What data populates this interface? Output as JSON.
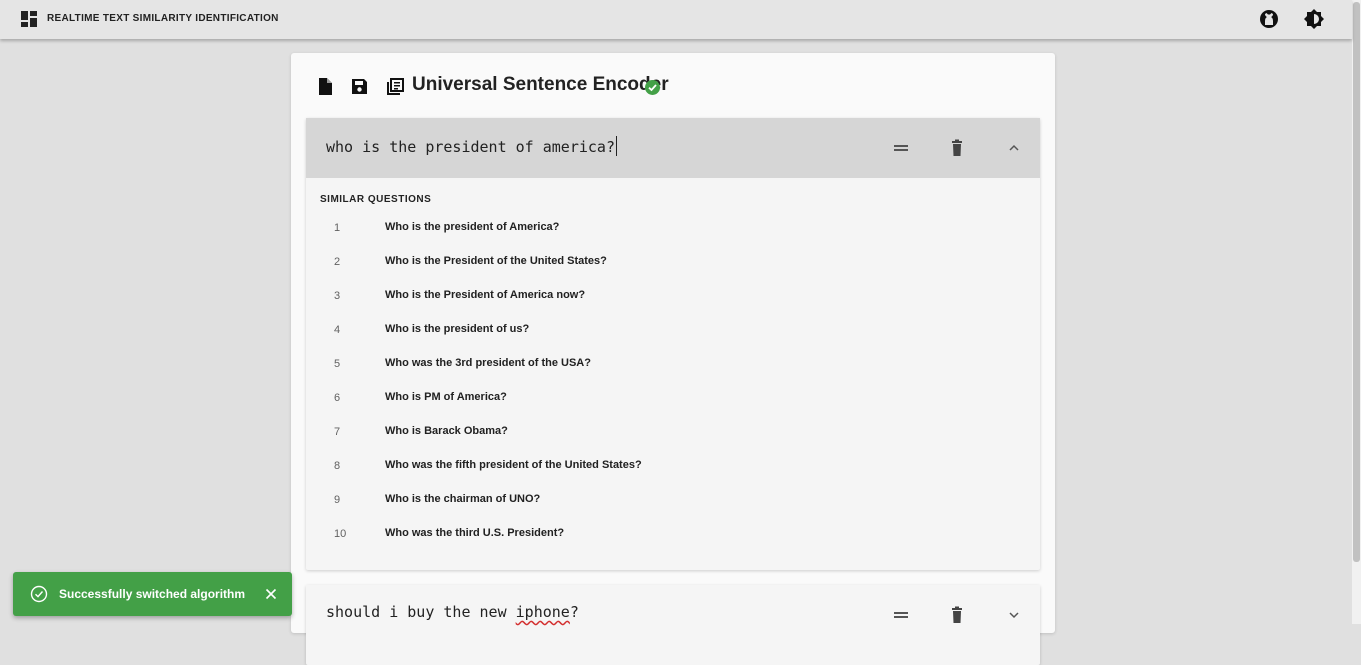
{
  "app": {
    "title": "REALTIME TEXT SIMILARITY IDENTIFICATION",
    "icons": [
      "dashboard-icon",
      "github-icon",
      "brightness-icon"
    ]
  },
  "toolbar": {
    "icons": [
      "new-file-icon",
      "save-icon",
      "library-icon",
      "check-circle-icon"
    ],
    "model_name": "Universal Sentence Encoder",
    "status_color": "#43a047"
  },
  "panels": [
    {
      "query": "who is the president of america?",
      "expanded": true,
      "similar_title": "SIMILAR QUESTIONS",
      "questions": [
        {
          "rank": "1",
          "text": "Who is the president of America?"
        },
        {
          "rank": "2",
          "text": "Who is the President of the United States?"
        },
        {
          "rank": "3",
          "text": "Who is the President of America now?"
        },
        {
          "rank": "4",
          "text": "Who is the president of us?"
        },
        {
          "rank": "5",
          "text": "Who was the 3rd president of the USA?"
        },
        {
          "rank": "6",
          "text": "Who is PM of America?"
        },
        {
          "rank": "7",
          "text": "Who is Barack Obama?"
        },
        {
          "rank": "8",
          "text": "Who was the fifth president of the United States?"
        },
        {
          "rank": "9",
          "text": "Who is the chairman of UNO?"
        },
        {
          "rank": "10",
          "text": "Who was the third U.S. President?"
        }
      ]
    },
    {
      "query_prefix": "should i buy the new ",
      "query_misspelled": "iphone",
      "query_suffix": "?",
      "expanded": false
    }
  ],
  "snackbar": {
    "message": "Successfully switched algorithm",
    "color": "#43a047"
  }
}
